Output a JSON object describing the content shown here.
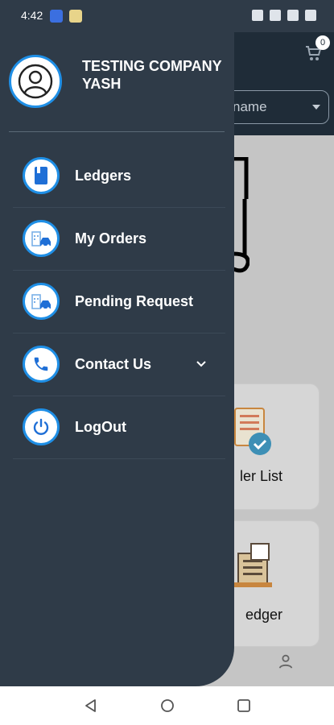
{
  "status_bar": {
    "time": "4:42",
    "icons": [
      "mute-icon",
      "calendar-icon",
      "signal-icon",
      "battery-icon"
    ]
  },
  "background": {
    "cart_count": "0",
    "dropdown_text": "name",
    "cards": [
      {
        "label": "ler List",
        "icon": "checklist-icon"
      },
      {
        "label": "edger",
        "icon": "ledger-icon"
      }
    ]
  },
  "drawer": {
    "profile_name": "TESTING COMPANY YASH",
    "menu_items": [
      {
        "label": "Ledgers",
        "icon": "book-icon"
      },
      {
        "label": "My Orders",
        "icon": "orders-icon"
      },
      {
        "label": "Pending Request",
        "icon": "orders-icon"
      },
      {
        "label": "Contact Us",
        "icon": "phone-icon",
        "expandable": true
      },
      {
        "label": "LogOut",
        "icon": "power-icon"
      }
    ]
  },
  "colors": {
    "drawer_bg": "#2f3b48",
    "accent": "#1f8fe6",
    "overlay": "#c5c5c5"
  }
}
